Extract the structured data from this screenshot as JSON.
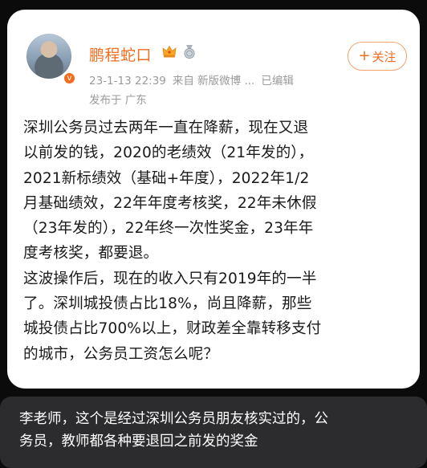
{
  "post": {
    "username": "鹏程蛇口",
    "timestamp": "23-1-13 22:39",
    "source": "来自 新版微博 ...",
    "edited": "已编辑",
    "location": "发布于 广东",
    "follow_label": "关注",
    "content": "深圳公务员过去两年一直在降薪，现在又退\n以前发的钱，2020的老绩效（21年发的），\n2021新标绩效（基础+年度），2022年1/2\n月基础绩效，22年年度考核奖，22年未休假\n（23年发的），22年终一次性奖金，23年年\n度考核奖，都要退。\n这波操作后，现在的收入只有2019年的一半\n了。深圳城投债占比18%，尚且降薪，那些\n城投债占比700%以上，财政差全靠转移支付\n的城市，公务员工资怎么呢？",
    "icons": {
      "verified": "verified-badge-icon",
      "crown": "crown-icon",
      "medal": "medal-icon"
    }
  },
  "caption": {
    "text": "李老师，这个是经过深圳公务员朋友核实过的，公\n务员，教师都各种要退回之前发的奖金"
  },
  "colors": {
    "accent": "#f26d1f",
    "background": "#0b0b0c",
    "card": "#ffffff",
    "caption_bg": "#2c2c2e"
  }
}
